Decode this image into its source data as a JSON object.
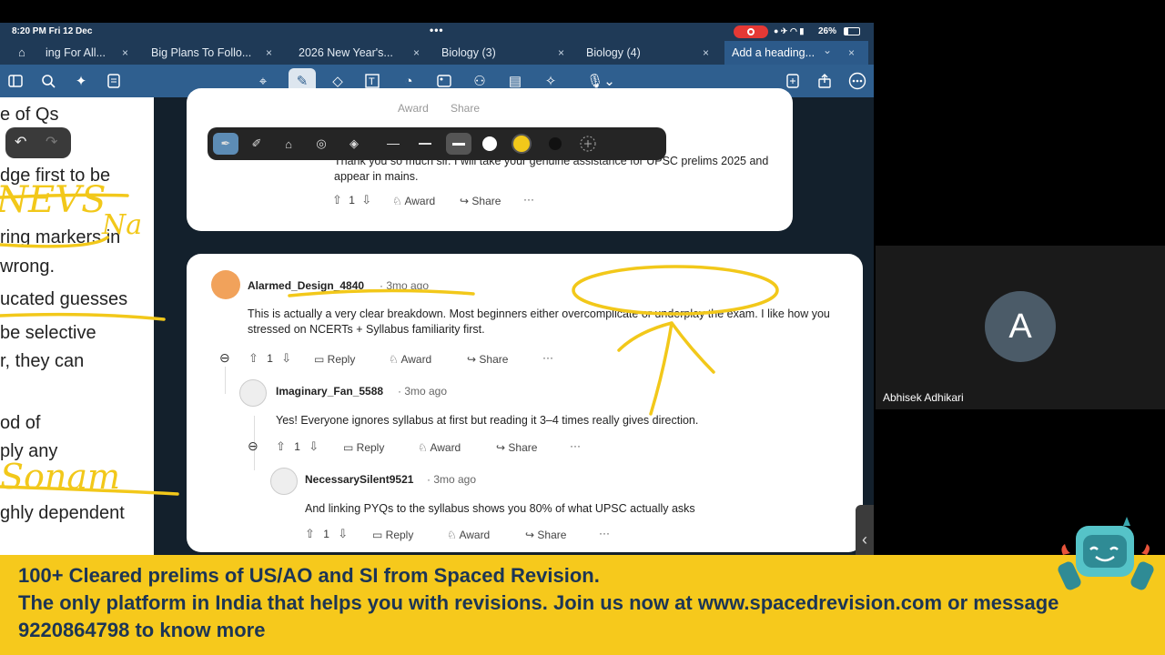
{
  "status": {
    "time": "8:20 PM  Fri 12 Dec",
    "dots": "•••",
    "battery": "26%",
    "icons": "● ✈ ◠ ▮"
  },
  "tabs": [
    {
      "label": "ing For All...",
      "active": false
    },
    {
      "label": "Big Plans To Follo...",
      "active": false
    },
    {
      "label": "2026 New Year's...",
      "active": false
    },
    {
      "label": "Biology (3)",
      "active": false
    },
    {
      "label": "Biology (4)",
      "active": false
    },
    {
      "label": "Add a heading...",
      "active": true
    }
  ],
  "tab_close": "×",
  "tab_chevron": "⌄",
  "left_doc_lines": [
    "e of Qs",
    "dge first to be",
    "ring markers in",
    " wrong.",
    "ucated guesses",
    " be selective",
    "r, they can",
    "od of",
    "ply any",
    "ghly dependent"
  ],
  "top_comment": {
    "text": "Thank you so much sir. I will take your genuine assistance for UPSC prelims 2025 and appear in mains.",
    "votes": "1",
    "award": "Award",
    "share": "Share",
    "more": "···",
    "hidden_award": "Award",
    "hidden_share": "Share"
  },
  "main_comment": {
    "user": "Alarmed_Design_4840",
    "ago": "· 3mo ago",
    "text": "This is actually a very clear breakdown. Most beginners either overcomplicate or underplay the exam. I like how you stressed on NCERTs + Syllabus familiarity first.",
    "votes": "1",
    "reply": "Reply",
    "award": "Award",
    "share": "Share",
    "more": "···"
  },
  "reply1": {
    "user": "Imaginary_Fan_5588",
    "ago": "· 3mo ago",
    "text": "Yes! Everyone ignores syllabus at first but reading it 3–4 times really gives direction.",
    "votes": "1",
    "reply": "Reply",
    "award": "Award",
    "share": "Share",
    "more": "···"
  },
  "reply2": {
    "user": "NecessarySilent9521",
    "ago": "· 3mo ago",
    "text": "And linking PYQs to the syllabus shows you 80% of what UPSC actually asks",
    "votes": "1",
    "reply": "Reply",
    "award": "Award",
    "share": "Share",
    "more": "···"
  },
  "participant": {
    "initial": "A",
    "name": "Abhisek Adhikari"
  },
  "banner": {
    "line1": "100+ Cleared prelims of US/AO and SI from Spaced Revision.",
    "line2": "The only platform in India that helps you with revisions. Join us now at www.spacedrevision.com or message",
    "line3": "9220864798 to know more"
  },
  "handwriting": [
    "NEVS",
    "Na",
    "Sonam"
  ],
  "colors": {
    "ink": "#f2c81a",
    "banner": "#f6c91c",
    "banner_text": "#1c3555",
    "toolbar": "#2f5f8f",
    "recording": "#e53935"
  },
  "icons": {
    "toolbar": [
      "sidebar-icon",
      "search-icon",
      "magic-icon",
      "document-icon",
      "lasso-icon",
      "pen-icon",
      "eraser-icon",
      "text-icon",
      "shape-icon",
      "image-icon",
      "elements-icon",
      "sticky-note-icon",
      "laser-icon",
      "mic-icon",
      "add-page-icon",
      "share-icon",
      "more-icon"
    ]
  }
}
